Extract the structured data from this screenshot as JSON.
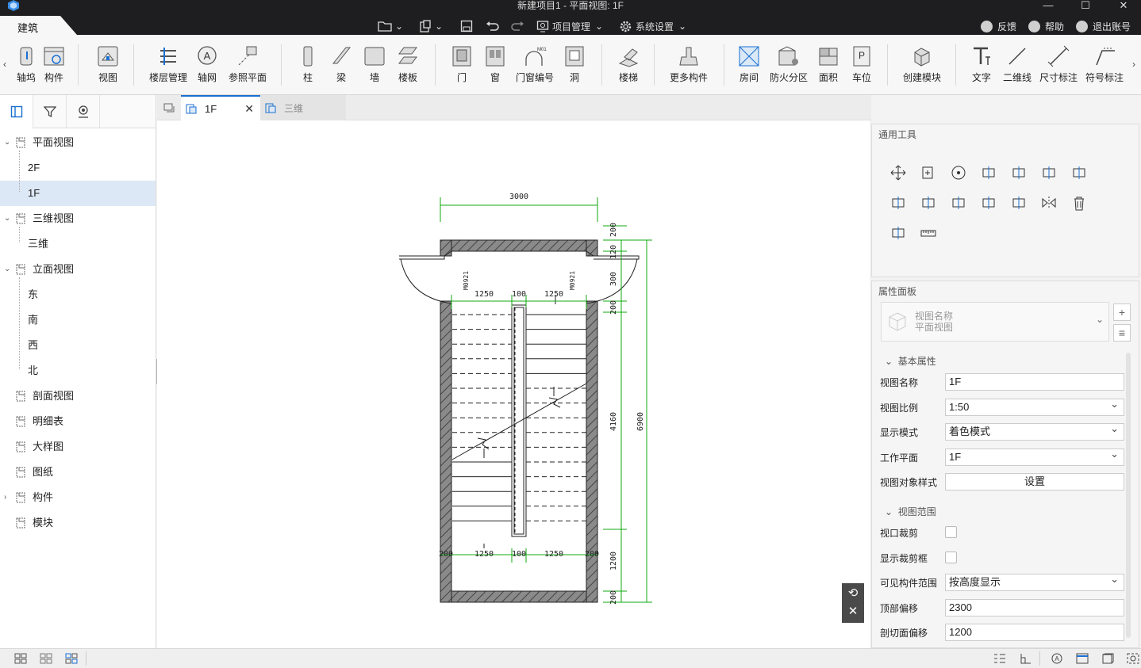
{
  "window": {
    "title": "新建项目1 - 平面视图: 1F",
    "controls": [
      "—",
      "☐",
      "✕"
    ]
  },
  "ribbon_tab": "建筑",
  "quick_access": {
    "project_menu": "项目管理",
    "settings_menu": "系统设置"
  },
  "right_links": {
    "feedback": "反馈",
    "help": "帮助",
    "logout": "退出账号"
  },
  "ribbon_buttons": [
    "轴网",
    "构件",
    "视图",
    "楼层管理",
    "轴网",
    "参照平面",
    "柱",
    "梁",
    "墙",
    "楼板",
    "门",
    "窗",
    "门窗编号",
    "洞",
    "楼梯",
    "更多构件",
    "房间",
    "防火分区",
    "面积",
    "车位",
    "创建模块",
    "文字",
    "二维线",
    "尺寸标注",
    "符号标注"
  ],
  "ribbon_first_label": "轴坞",
  "sidebar": {
    "tabs": [
      "panel-icon",
      "filter-icon",
      "node-icon"
    ],
    "tree": [
      {
        "label": "平面视图",
        "level": 0,
        "expand": "⌄"
      },
      {
        "label": "2F",
        "level": 1
      },
      {
        "label": "1F",
        "level": 1,
        "selected": true
      },
      {
        "label": "三维视图",
        "level": 0,
        "expand": "⌄"
      },
      {
        "label": "三维",
        "level": 1
      },
      {
        "label": "立面视图",
        "level": 0,
        "expand": "⌄"
      },
      {
        "label": "东",
        "level": 1
      },
      {
        "label": "南",
        "level": 1
      },
      {
        "label": "西",
        "level": 1
      },
      {
        "label": "北",
        "level": 1
      },
      {
        "label": "剖面视图",
        "level": 0
      },
      {
        "label": "明细表",
        "level": 0
      },
      {
        "label": "大样图",
        "level": 0
      },
      {
        "label": "图纸",
        "level": 0
      },
      {
        "label": "构件",
        "level": 0,
        "expand": "›"
      },
      {
        "label": "模块",
        "level": 0
      }
    ]
  },
  "doc_tabs": [
    {
      "label": "1F",
      "active": true,
      "close": "✕"
    },
    {
      "label": "三维",
      "active": false
    }
  ],
  "drawing": {
    "dim_top": "3000",
    "dim_left_upper": "1250",
    "dim_mid_upper": "100",
    "dim_right_upper": "1250",
    "dim_left_lower": "1250",
    "dim_mid_lower": "100",
    "dim_right_lower": "1250",
    "dim_200_left": "200",
    "dim_200_right": "200",
    "dim_total": "6900",
    "dim_run": "4160",
    "dim_1200": "1200",
    "dim_200_top": "200",
    "dim_1200_top": "120",
    "dim_300": "300",
    "dim_200_mid": "200",
    "dim_200_bot": "200",
    "door_left": "M0921",
    "door_right": "M0921"
  },
  "tool_panel": {
    "title": "通用工具"
  },
  "prop_panel": {
    "title": "属性面板",
    "selector_name": "视图名称",
    "selector_type": "平面视图",
    "section_basic": "基本属性",
    "section_range": "视图范围",
    "rows": [
      {
        "label": "视图名称",
        "value": "1F",
        "type": "text"
      },
      {
        "label": "视图比例",
        "value": "1:50",
        "type": "dropdown"
      },
      {
        "label": "显示模式",
        "value": "着色模式",
        "type": "dropdown"
      },
      {
        "label": "工作平面",
        "value": "1F",
        "type": "dropdown"
      },
      {
        "label": "视图对象样式",
        "value": "设置",
        "type": "button"
      }
    ],
    "range_rows": [
      {
        "label": "视口裁剪",
        "type": "checkbox"
      },
      {
        "label": "显示裁剪框",
        "type": "checkbox"
      },
      {
        "label": "可见构件范围",
        "value": "按高度显示",
        "type": "dropdown"
      },
      {
        "label": "顶部偏移",
        "value": "2300",
        "type": "text"
      },
      {
        "label": "剖切面偏移",
        "value": "1200",
        "type": "text"
      }
    ]
  },
  "colors": {
    "titlebar": "#1e1e20",
    "accent": "#1a6fd1",
    "dim_green": "#11a811",
    "wall_hatch": "#555555"
  }
}
